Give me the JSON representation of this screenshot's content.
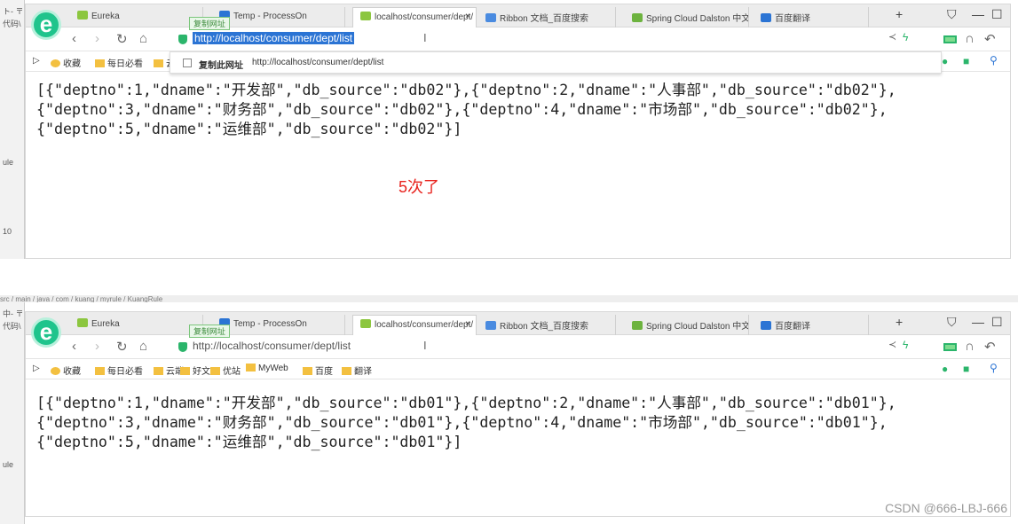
{
  "browsers": [
    {
      "ide_labels": [
        "ト- 〒",
        "代码\\",
        "ule",
        "10"
      ],
      "tabs": [
        "Eureka",
        "Temp - ProcessOn",
        "localhost/consumer/dept/",
        "Ribbon 文档_百度搜索",
        "Spring Cloud Dalston 中文",
        "百度翻译"
      ],
      "active_tab": 2,
      "copy_tip": "复制网址",
      "url": "http://localhost/consumer/dept/list",
      "url_selected": true,
      "dropdown": {
        "label": "复制此网址",
        "url": "http://localhost/consumer/dept/list"
      },
      "bookmarks": [
        "收藏",
        "每日必看",
        "云"
      ],
      "json_lines": [
        "[{\"deptno\":1,\"dname\":\"开发部\",\"db_source\":\"db02\"},{\"deptno\":2,\"dname\":\"人事部\",\"db_source\":\"db02\"},",
        "{\"deptno\":3,\"dname\":\"财务部\",\"db_source\":\"db02\"},{\"deptno\":4,\"dname\":\"市场部\",\"db_source\":\"db02\"},",
        "{\"deptno\":5,\"dname\":\"运维部\",\"db_source\":\"db02\"}]"
      ],
      "note": "5次了"
    },
    {
      "ide_labels": [
        "中- 〒",
        "代码\\",
        "ule",
        ""
      ],
      "tabs": [
        "Eureka",
        "Temp - ProcessOn",
        "localhost/consumer/dept/",
        "Ribbon 文档_百度搜索",
        "Spring Cloud Dalston 中文",
        "百度翻译"
      ],
      "active_tab": 2,
      "copy_tip": "复制网址",
      "url": "http://localhost/consumer/dept/list",
      "url_selected": false,
      "bookmarks": [
        "收藏",
        "每日必看",
        "云端",
        "好文",
        "优站",
        "MyWeb",
        "百度",
        "翻译"
      ],
      "json_lines": [
        "[{\"deptno\":1,\"dname\":\"开发部\",\"db_source\":\"db01\"},{\"deptno\":2,\"dname\":\"人事部\",\"db_source\":\"db01\"},",
        "{\"deptno\":3,\"dname\":\"财务部\",\"db_source\":\"db01\"},{\"deptno\":4,\"dname\":\"市场部\",\"db_source\":\"db01\"},",
        "{\"deptno\":5,\"dname\":\"运维部\",\"db_source\":\"db01\"}]"
      ]
    }
  ],
  "ide_breadcrumb": "src / main / java / com / kuang / myrule / KuangRule",
  "watermark": "CSDN @666-LBJ-666",
  "colors": {
    "accent": "#2b74d4",
    "note": "#e8231e",
    "logo": "#1fc48c"
  }
}
